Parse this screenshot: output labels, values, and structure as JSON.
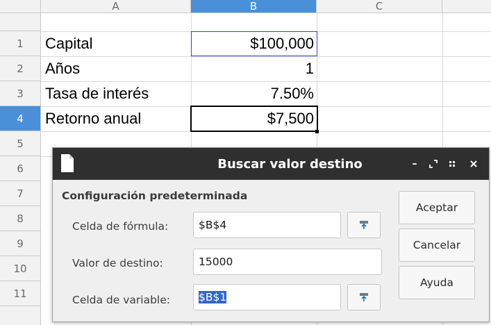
{
  "sheet": {
    "columns": [
      "A",
      "B",
      "C"
    ],
    "rows": [
      "1",
      "2",
      "3",
      "4",
      "5",
      "6",
      "7",
      "8",
      "9",
      "10",
      "11"
    ],
    "selected_column": "B",
    "selected_row": "4",
    "cells": {
      "A1": "Capital",
      "B1": "$100,000",
      "A2": "Años",
      "B2": "1",
      "A3": "Tasa de interés",
      "B3": "7.50%",
      "A4": "Retorno anual",
      "B4": "$7,500"
    },
    "colors": {
      "header_selected": "#4a90d9",
      "b1_border": "#3a3adf"
    }
  },
  "dialog": {
    "title": "Buscar valor destino",
    "window_controls": {
      "minimize": "–",
      "maximize": "⤢",
      "menu": "∷",
      "close": "×"
    },
    "section_title": "Configuración predeterminada",
    "formula_cell": {
      "label": "Celda de fórmula:",
      "value": "$B$4"
    },
    "target_value": {
      "label": "Valor de destino:",
      "value": "15000"
    },
    "variable_cell": {
      "label": "Celda de variable:",
      "value": "$B$1",
      "selected": true
    },
    "buttons": {
      "accept": "Aceptar",
      "cancel": "Cancelar",
      "help": "Ayuda"
    },
    "icons": {
      "app": "document-icon",
      "shrink": "shrink-icon"
    },
    "colors": {
      "titlebar": "#2f2f2f",
      "selection": "#3366cc"
    }
  }
}
